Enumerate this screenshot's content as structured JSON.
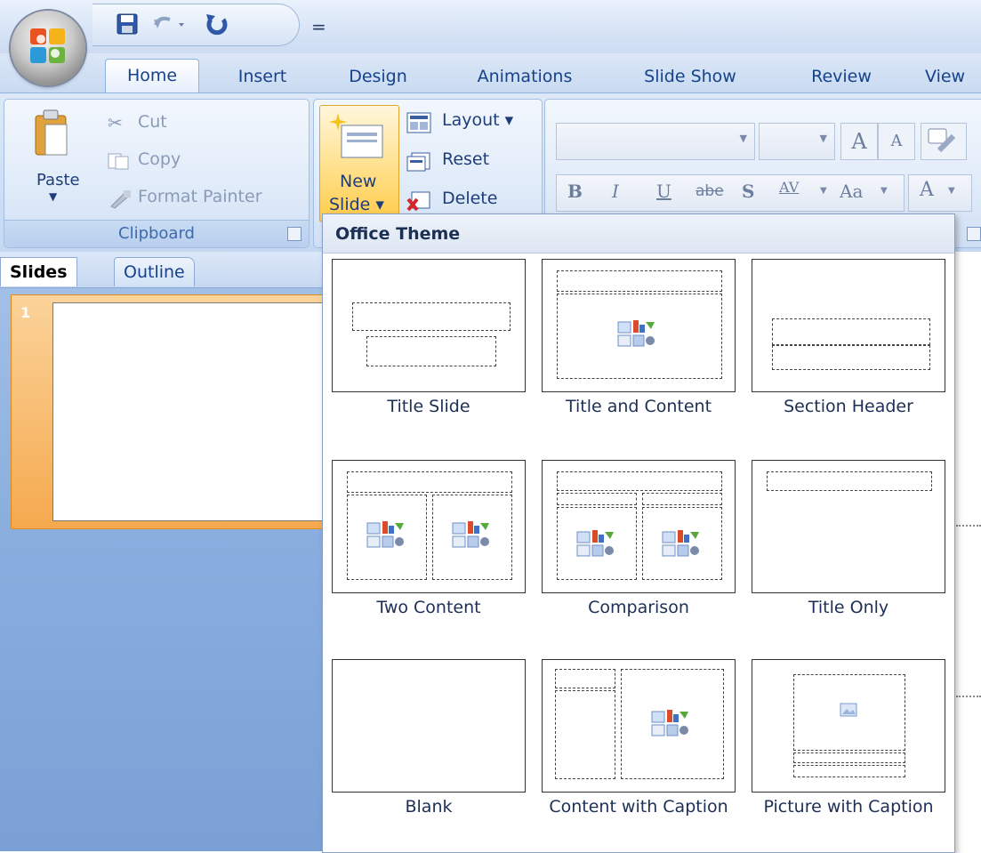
{
  "quick_access": {
    "save_icon": "save-icon",
    "undo_icon": "undo-icon",
    "redo_icon": "redo-icon",
    "customize_glyph": "="
  },
  "tabs": [
    {
      "label": "Home",
      "active": true
    },
    {
      "label": "Insert"
    },
    {
      "label": "Design"
    },
    {
      "label": "Animations"
    },
    {
      "label": "Slide Show"
    },
    {
      "label": "Review"
    },
    {
      "label": "View"
    }
  ],
  "clipboard": {
    "paste_label": "Paste",
    "cut_label": "Cut",
    "copy_label": "Copy",
    "format_painter_label": "Format Painter",
    "group_label": "Clipboard"
  },
  "slides_group": {
    "new_slide_line1": "New",
    "new_slide_line2": "Slide ▾",
    "layout_label": "Layout ▾",
    "reset_label": "Reset",
    "delete_label": "Delete"
  },
  "font_group": {
    "font_name_value": "",
    "font_size_value": "",
    "grow_label": "A",
    "shrink_label": "A",
    "bold_label": "B",
    "italic_label": "I",
    "underline_label": "U",
    "strike_label": "abe",
    "shadow_label": "S",
    "spacing_label": "AV",
    "case_label": "Aa",
    "color_label": "A"
  },
  "pane": {
    "tab_slides": "Slides",
    "tab_outline": "Outline",
    "slide_number": "1"
  },
  "gallery": {
    "header": "Office Theme",
    "layouts": [
      {
        "label": "Title Slide"
      },
      {
        "label": "Title and Content"
      },
      {
        "label": "Section Header"
      },
      {
        "label": "Two Content"
      },
      {
        "label": "Comparison"
      },
      {
        "label": "Title Only"
      },
      {
        "label": "Blank"
      },
      {
        "label": "Content with Caption"
      },
      {
        "label": "Picture with Caption"
      }
    ]
  },
  "colors": {
    "accent_orange": "#f5a94e",
    "ribbon_blue": "#c4d8f1",
    "text_blue": "#15428b"
  }
}
